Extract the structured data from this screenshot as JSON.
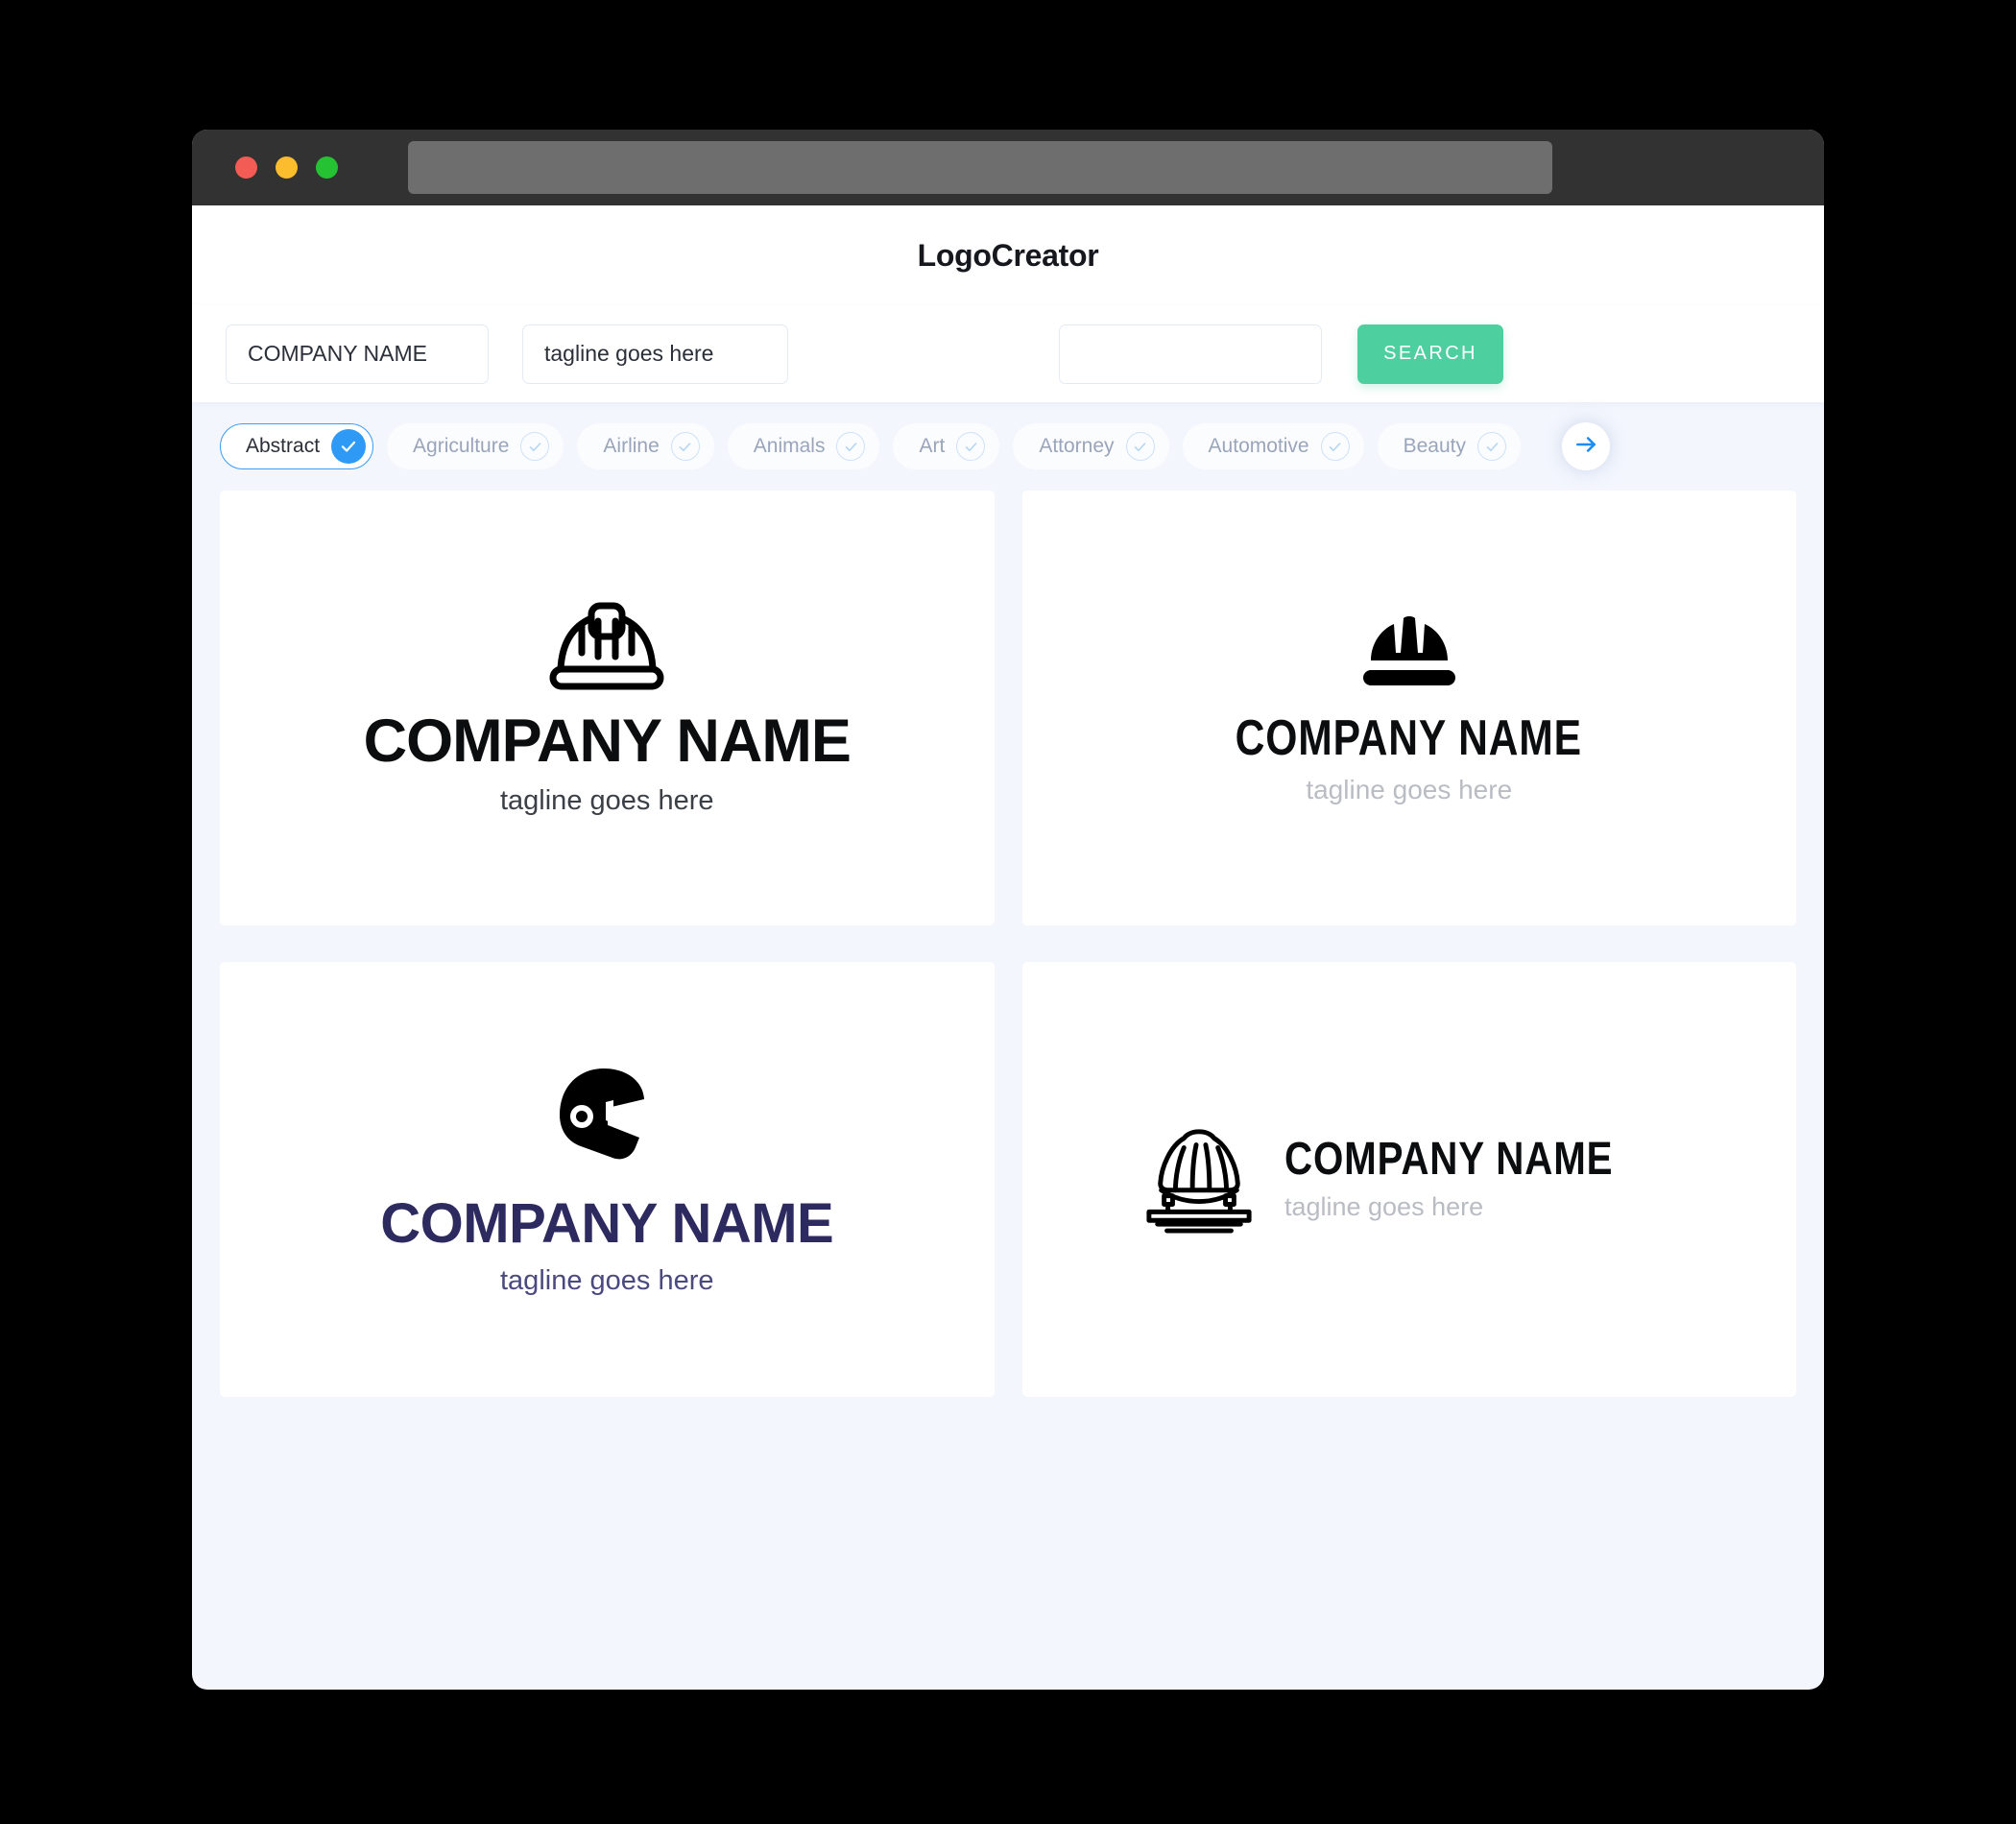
{
  "window": {
    "traffic_lights": [
      {
        "name": "close",
        "color": "#f25c55"
      },
      {
        "name": "minimize",
        "color": "#fbbc2e"
      },
      {
        "name": "maximize",
        "color": "#25c333"
      }
    ],
    "url_value": ""
  },
  "header": {
    "title": "LogoCreator"
  },
  "search": {
    "company_name_value": "COMPANY NAME",
    "company_name_placeholder": "COMPANY NAME",
    "tagline_value": "tagline goes here",
    "tagline_placeholder": "tagline goes here",
    "extra_value": "",
    "extra_placeholder": "",
    "search_label": "SEARCH",
    "search_button_color": "#4ecfa0"
  },
  "categories": {
    "next_icon": "arrow-right-icon",
    "accent_color": "#2f9af5",
    "items": [
      {
        "label": "Abstract",
        "selected": true
      },
      {
        "label": "Agriculture",
        "selected": false
      },
      {
        "label": "Airline",
        "selected": false
      },
      {
        "label": "Animals",
        "selected": false
      },
      {
        "label": "Art",
        "selected": false
      },
      {
        "label": "Attorney",
        "selected": false
      },
      {
        "label": "Automotive",
        "selected": false
      },
      {
        "label": "Beauty",
        "selected": false
      }
    ]
  },
  "logos": [
    {
      "id": "logo-1",
      "mark": "hard-hat-outline-icon",
      "name": "COMPANY NAME",
      "tagline": "tagline goes here",
      "name_color": "#0c0d0f",
      "tagline_color": "#3b3f46",
      "layout": "stacked"
    },
    {
      "id": "logo-2",
      "mark": "hard-hat-solid-icon",
      "name": "COMPANY NAME",
      "tagline": "tagline goes here",
      "name_color": "#0c0d0f",
      "tagline_color": "#b9bcc3",
      "layout": "stacked"
    },
    {
      "id": "logo-3",
      "mark": "racing-helmet-icon",
      "name": "COMPANY NAME",
      "tagline": "tagline goes here",
      "name_color": "#2c2a5e",
      "tagline_color": "#4b4a80",
      "layout": "stacked"
    },
    {
      "id": "logo-4",
      "mark": "hard-hat-lines-icon",
      "name": "COMPANY NAME",
      "tagline": "tagline goes here",
      "name_color": "#0c0d0f",
      "tagline_color": "#b9bcc3",
      "layout": "horizontal"
    }
  ]
}
